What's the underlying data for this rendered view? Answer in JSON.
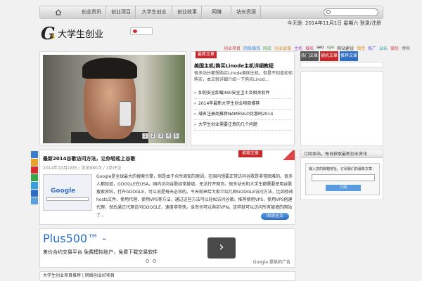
{
  "nav": {
    "items": [
      "首页",
      "创业资讯",
      "创业项目",
      "大学生创业",
      "创业故事",
      "网赚",
      "站长资源"
    ]
  },
  "header": {
    "logo_letter": "G",
    "logo_badge": "5",
    "site_title": "大学生创业",
    "date": "今天是: 2014年11月1日 星期六 登录/注册"
  },
  "tags": [
    {
      "text": "创业项目",
      "color": "#d04848"
    },
    {
      "text": "网络赚钱",
      "color": "#4a8bd8"
    },
    {
      "text": "网店",
      "color": "#55aa55"
    },
    {
      "text": "创业故事",
      "color": "#d88a2b"
    },
    {
      "text": "主机",
      "color": "#9a4fd0"
    },
    {
      "text": "域名",
      "color": "#cc3366"
    },
    {
      "text": "seo",
      "color": "#222222"
    },
    {
      "text": "vps",
      "color": "#3d7a2e"
    },
    {
      "text": "网站建设",
      "color": "#444444"
    },
    {
      "text": "淘宝",
      "color": "#e08a00"
    },
    {
      "text": "推广",
      "color": "#6a6ad0"
    },
    {
      "text": "站长",
      "color": "#2f9fa0"
    },
    {
      "text": "微信",
      "color": "#cc4444"
    },
    {
      "text": "博客",
      "color": "#777777"
    }
  ],
  "slider": {
    "pages": [
      "1",
      "2",
      "3",
      "4",
      "5"
    ]
  },
  "news": {
    "tab": "最新文章",
    "headline": "美国主机|购买Linode主机详细教程",
    "desc": "很多站长都想购买Linode美国主机，但是不知道如何购买，本文就详细介绍一下购买Linod...",
    "list": [
      "如何安全卸载360安全卫士及相关软件",
      "2014年最新大学生创业项目推荐",
      "域名注册商推荐NAMESILO优惠码2014",
      "大学生创业需要注意的几个问题"
    ]
  },
  "right_tabs": [
    {
      "label": "热门文章",
      "color": "#555555"
    },
    {
      "label": "随机文章",
      "color": "#c8282c"
    },
    {
      "label": "推荐文章",
      "color": "#2e6ec4"
    }
  ],
  "article": {
    "tab": "推荐文章",
    "title": "最新2014谷歌访问方法，让你轻松上谷歌",
    "meta": "2014年10月18日 / 浏览880次 / 1条评论",
    "thumb_word": "Google",
    "body": "Google是全球最大的搜索引擎，但是由于众所周知的原因，在国内想要正常访问谷歌是非常困难的。很多人都知道，GOOGLE在USA，国内访问谷歌经常被墙，无法打开网页。很多站长和大学生都需要使用谷歌搜索资料，打开GOOGLE，可以说是每天必须的。今天就来给大家介绍几种GOOGLE访问方法，比如修改hosts文件、使用代理、使用VPS等方法，通过这些方法可以轻松访问谷歌。推荐使用VPS，使用VPS搭建代理，然后通过代理访问GOOGLE，速度非常快。当然也可以购买VPN，这样就可以访问所有被墙的网站了...",
    "more": "阅读全文"
  },
  "ad": {
    "title": "Plus500™ -",
    "subtitle": "差价合约交易平台  免费模拟账户，免费下载交易软件",
    "arrow": "›",
    "tag": "Google 提供的广告"
  },
  "bottom_box": {
    "text": "大学生创业项目推荐 | 网络创业好项目"
  },
  "subscribe": {
    "heading": "订阅本站，每日获取最新创业资讯",
    "hint": "输入您的邮箱地址，订阅我们的最新文章：",
    "button": "订阅"
  }
}
